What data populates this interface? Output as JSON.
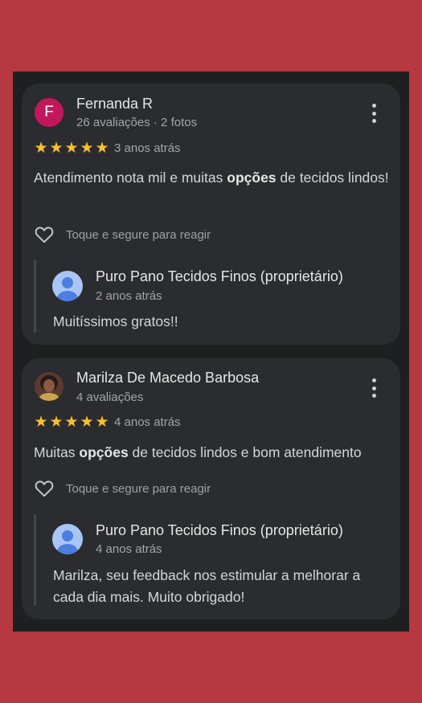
{
  "reviews": [
    {
      "avatar_letter": "F",
      "avatar_color": "#c2185b",
      "name": "Fernanda R",
      "meta": "26 avaliações · 2 fotos",
      "rating": 5,
      "date": "3 anos atrás",
      "text_before": "Atendimento nota mil e muitas ",
      "text_bold": "opções",
      "text_after": " de tecidos lindos!",
      "react_label": "Toque e segure para reagir",
      "owner_reply": {
        "name": "Puro Pano Tecidos Finos (proprietário)",
        "date": "2 anos atrás",
        "text": "Muitíssimos gratos!!"
      }
    },
    {
      "avatar_letter": "",
      "name": "Marilza De Macedo Barbosa",
      "meta": "4 avaliações",
      "rating": 5,
      "date": "4 anos atrás",
      "text_before": "Muitas ",
      "text_bold": "opções",
      "text_after": " de tecidos lindos e bom atendimento",
      "react_label": "Toque e segure para reagir",
      "owner_reply": {
        "name": "Puro Pano Tecidos Finos (proprietário)",
        "date": "4 anos atrás",
        "text": "Marilza, seu feedback nos estimular a melhorar a cada dia mais. Muito obrigado!"
      }
    }
  ],
  "icons": {
    "star": "star-icon",
    "heart": "heart-outline-icon",
    "more": "more-vert-icon",
    "owner_avatar": "default-profile-icon"
  },
  "colors": {
    "background": "#b63841",
    "card": "#2b2c2f",
    "star": "#fbc02d",
    "owner_avatar": "#a9c5f5"
  }
}
